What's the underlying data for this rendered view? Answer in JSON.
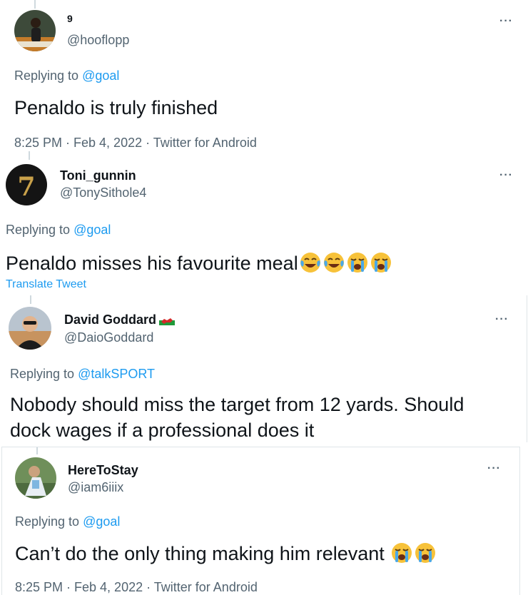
{
  "tweets": [
    {
      "name": "9",
      "handle": "@hooflopp",
      "replying_prefix": "Replying to",
      "replying_to": "@goal",
      "text": "Penaldo is truly finished",
      "meta": "8:25 PM · Feb 4, 2022 · Twitter for Android"
    },
    {
      "name": "Toni_gunnin",
      "handle": "@TonySithole4",
      "replying_prefix": "Replying to",
      "replying_to": "@goal",
      "text": "Penaldo misses his favourite meal",
      "emojis": [
        "face-with-tears-of-joy",
        "face-with-tears-of-joy",
        "loudly-crying-face",
        "loudly-crying-face"
      ],
      "translate": "Translate Tweet"
    },
    {
      "name": "David Goddard",
      "handle": "@DaioGoddard",
      "badge": "wales-flag",
      "replying_prefix": "Replying to",
      "replying_to": "@talkSPORT",
      "text_line1": "Nobody should miss the target from 12 yards. Should",
      "text_line2": "dock wages if a professional does it"
    },
    {
      "name": "HereToStay",
      "handle": "@iam6iiix",
      "replying_prefix": "Replying to",
      "replying_to": "@goal",
      "text": "Can’t do the only thing making him relevant",
      "emojis": [
        "loudly-crying-face",
        "loudly-crying-face"
      ],
      "meta": "8:25 PM · Feb 4, 2022 · Twitter for Android"
    }
  ],
  "more_glyph": "···",
  "colors": {
    "text": "#0f1419",
    "secondary": "#536471",
    "link": "#1d9bf0",
    "emoji_yellow": "#f7c23a",
    "tear_blue": "#4aa8e8"
  }
}
